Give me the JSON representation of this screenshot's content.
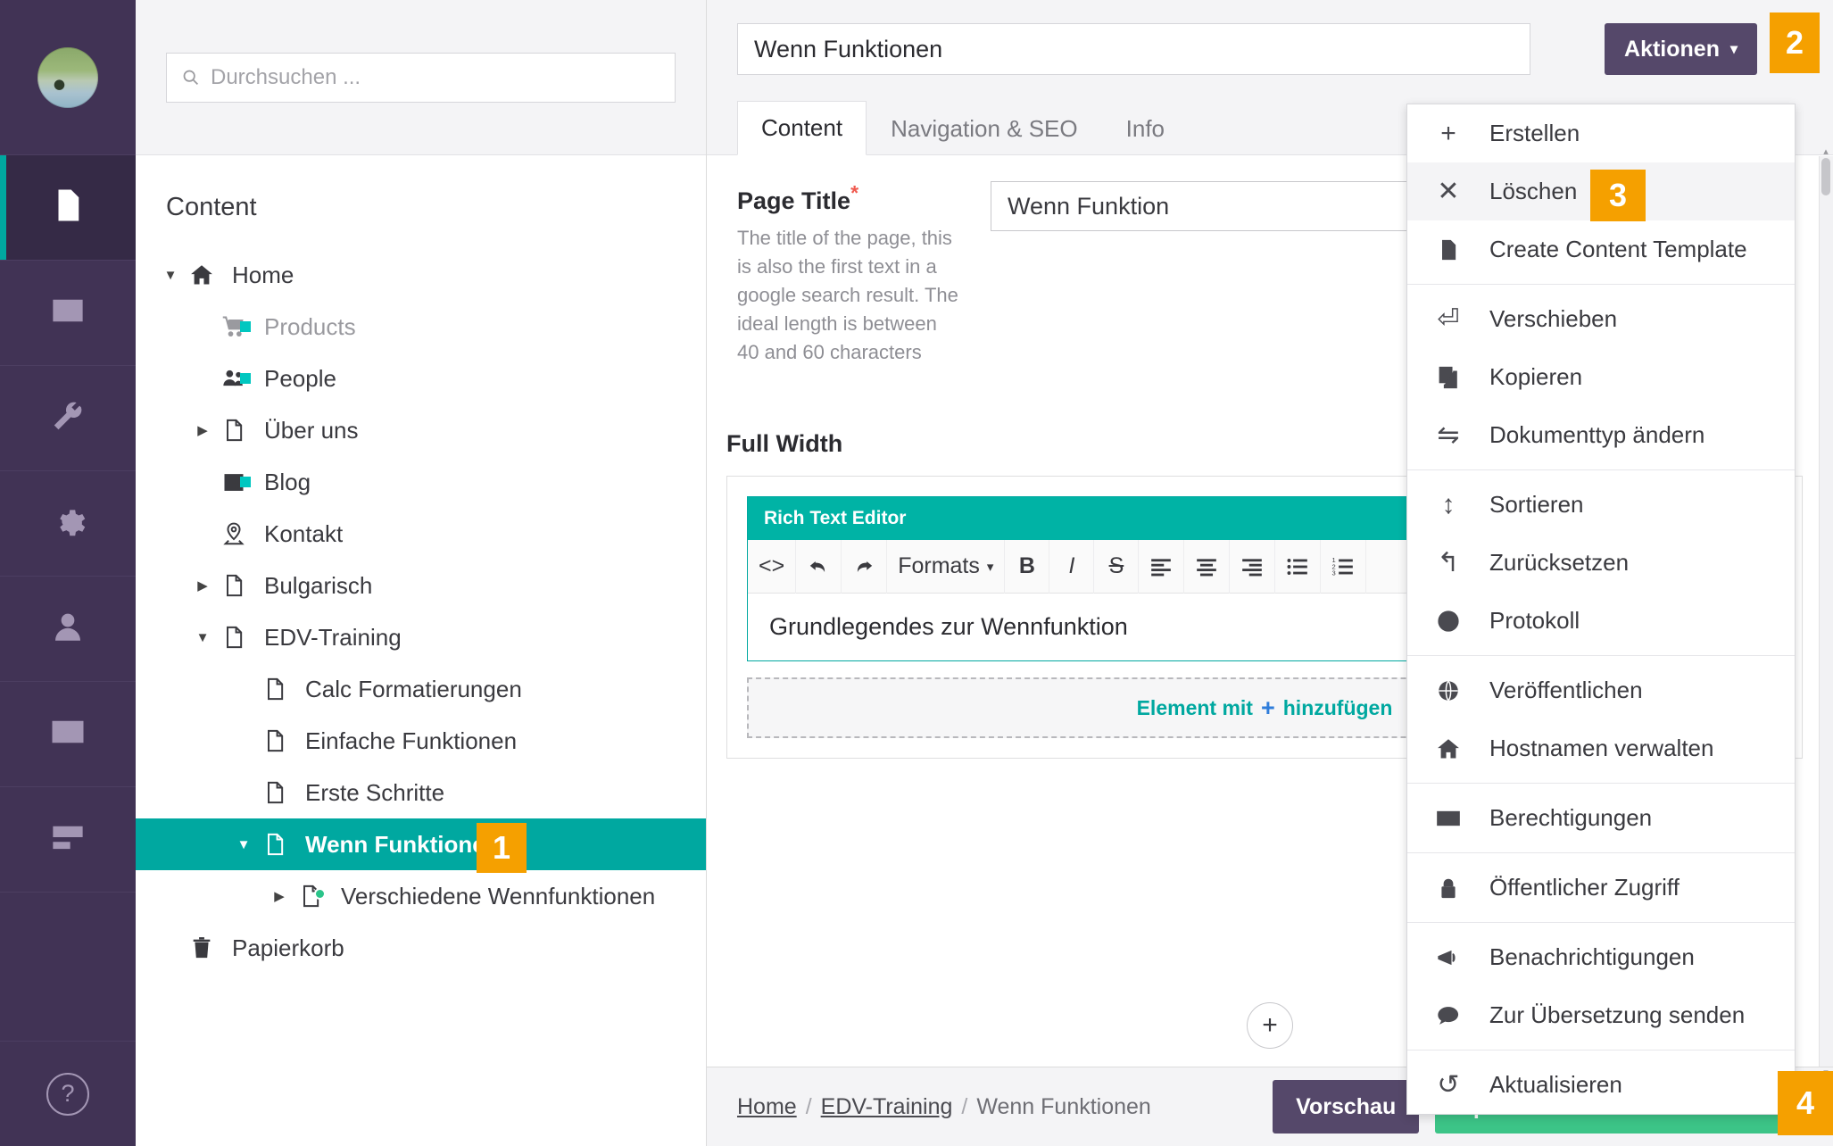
{
  "colors": {
    "rail_bg": "#413355",
    "rail_active": "#352a46",
    "teal": "#00a8a0",
    "orange": "#f5a000",
    "green_publish": "#3cc487",
    "purple_button": "#55486a",
    "required_red": "#f05a4f"
  },
  "rail": {
    "avatar_name": "user-avatar",
    "items": [
      {
        "name": "sidebar-item-content",
        "icon": "document-icon",
        "active": true
      },
      {
        "name": "sidebar-item-media",
        "icon": "image-icon",
        "active": false
      },
      {
        "name": "sidebar-item-settings",
        "icon": "wrench-icon",
        "active": false
      },
      {
        "name": "sidebar-item-packages",
        "icon": "gear-icon",
        "active": false
      },
      {
        "name": "sidebar-item-users",
        "icon": "user-icon",
        "active": false
      },
      {
        "name": "sidebar-item-members",
        "icon": "id-card-icon",
        "active": false
      },
      {
        "name": "sidebar-item-forms",
        "icon": "forms-icon",
        "active": false
      }
    ],
    "help_glyph": "?"
  },
  "search": {
    "placeholder": "Durchsuchen ...",
    "value": "",
    "icon": "search-icon"
  },
  "tree": {
    "title": "Content",
    "nodes": [
      {
        "label": "Home",
        "level": 1,
        "caret": "down",
        "icon": "home-icon",
        "dim": false,
        "selected": false,
        "dot": false
      },
      {
        "label": "Products",
        "level": 2,
        "caret": "none",
        "icon": "cart-icon",
        "dim": true,
        "selected": false,
        "dot": false
      },
      {
        "label": "People",
        "level": 2,
        "caret": "none",
        "icon": "people-icon",
        "dim": false,
        "selected": false,
        "dot": false
      },
      {
        "label": "Über uns",
        "level": 2,
        "caret": "right",
        "icon": "page-icon",
        "dim": false,
        "selected": false,
        "dot": false
      },
      {
        "label": "Blog",
        "level": 2,
        "caret": "none",
        "icon": "calendar-icon",
        "dim": false,
        "selected": false,
        "dot": false
      },
      {
        "label": "Kontakt",
        "level": 2,
        "caret": "none",
        "icon": "pin-icon",
        "dim": false,
        "selected": false,
        "dot": false
      },
      {
        "label": "Bulgarisch",
        "level": 2,
        "caret": "right",
        "icon": "page-icon",
        "dim": false,
        "selected": false,
        "dot": false
      },
      {
        "label": "EDV-Training",
        "level": 2,
        "caret": "down",
        "icon": "page-icon",
        "dim": false,
        "selected": false,
        "dot": false
      },
      {
        "label": "Calc Formatierungen",
        "level": 3,
        "caret": "none",
        "icon": "page-icon",
        "dim": false,
        "selected": false,
        "dot": false
      },
      {
        "label": "Einfache Funktionen",
        "level": 3,
        "caret": "none",
        "icon": "page-icon",
        "dim": false,
        "selected": false,
        "dot": false
      },
      {
        "label": "Erste Schritte",
        "level": 3,
        "caret": "none",
        "icon": "page-icon",
        "dim": false,
        "selected": false,
        "dot": false
      },
      {
        "label": "Wenn Funktionen",
        "level": 3,
        "caret": "down",
        "icon": "page-icon",
        "dim": false,
        "selected": true,
        "dot": false
      },
      {
        "label": "Verschiedene Wennfunktionen",
        "level": 4,
        "caret": "right",
        "icon": "page-icon",
        "dim": false,
        "selected": false,
        "dot": true
      },
      {
        "label": "Papierkorb",
        "level": 1,
        "caret": "none",
        "icon": "trash-icon",
        "dim": false,
        "selected": false,
        "dot": false
      }
    ]
  },
  "editor": {
    "name_value": "Wenn Funktionen",
    "actions_label": "Aktionen",
    "actions_caret": "chevron-down-icon",
    "tabs": [
      {
        "label": "Content",
        "active": true
      },
      {
        "label": "Navigation & SEO",
        "active": false
      },
      {
        "label": "Info",
        "active": false
      }
    ],
    "property": {
      "label": "Page Title",
      "required_marker": "*",
      "description": "The title of the page, this is also the first text in a google search result. The ideal length is between 40 and 60 characters",
      "value": "Wenn Funktion"
    },
    "grid": {
      "section_label": "Full Width",
      "rte_title": "Rich Text Editor",
      "rte_content": "Grundlegendes zur Wennfunktion",
      "toolbar": [
        {
          "name": "source-code-button",
          "glyph": "<>"
        },
        {
          "name": "undo-button",
          "glyph": ""
        },
        {
          "name": "redo-button",
          "glyph": ""
        },
        {
          "name": "formats-dropdown",
          "glyph": "Formats"
        },
        {
          "name": "bold-button",
          "glyph": "B"
        },
        {
          "name": "italic-button",
          "glyph": "I"
        },
        {
          "name": "strikethrough-button",
          "glyph": "S"
        },
        {
          "name": "align-left-button",
          "glyph": ""
        },
        {
          "name": "align-center-button",
          "glyph": ""
        },
        {
          "name": "align-right-button",
          "glyph": ""
        },
        {
          "name": "bullet-list-button",
          "glyph": ""
        },
        {
          "name": "numbered-list-button",
          "glyph": ""
        }
      ],
      "add_element_pre": "Element mit",
      "add_element_plus": "+",
      "add_element_post": "hinzufügen",
      "add_row_glyph": "+"
    }
  },
  "actions_menu": {
    "items": [
      {
        "label": "Erstellen",
        "icon": "plus-icon",
        "highlight": false,
        "sep_after": false
      },
      {
        "label": "Löschen",
        "icon": "close-icon",
        "highlight": true,
        "sep_after": false
      },
      {
        "label": "Create Content Template",
        "icon": "content-template-icon",
        "highlight": false,
        "sep_after": true
      },
      {
        "label": "Verschieben",
        "icon": "move-icon",
        "highlight": false,
        "sep_after": false
      },
      {
        "label": "Kopieren",
        "icon": "copy-icon",
        "highlight": false,
        "sep_after": false
      },
      {
        "label": "Dokumenttyp ändern",
        "icon": "swap-icon",
        "highlight": false,
        "sep_after": true
      },
      {
        "label": "Sortieren",
        "icon": "sort-icon",
        "highlight": false,
        "sep_after": false
      },
      {
        "label": "Zurücksetzen",
        "icon": "rollback-icon",
        "highlight": false,
        "sep_after": false
      },
      {
        "label": "Protokoll",
        "icon": "clock-icon",
        "highlight": false,
        "sep_after": true
      },
      {
        "label": "Veröffentlichen",
        "icon": "globe-icon",
        "highlight": false,
        "sep_after": false
      },
      {
        "label": "Hostnamen verwalten",
        "icon": "home-icon",
        "highlight": false,
        "sep_after": true
      },
      {
        "label": "Berechtigungen",
        "icon": "permissions-icon",
        "highlight": false,
        "sep_after": true
      },
      {
        "label": "Öffentlicher Zugriff",
        "icon": "lock-icon",
        "highlight": false,
        "sep_after": true
      },
      {
        "label": "Benachrichtigungen",
        "icon": "megaphone-icon",
        "highlight": false,
        "sep_after": false
      },
      {
        "label": "Zur Übersetzung senden",
        "icon": "speech-bubble-icon",
        "highlight": false,
        "sep_after": true
      },
      {
        "label": "Aktualisieren",
        "icon": "refresh-icon",
        "highlight": false,
        "sep_after": false
      }
    ]
  },
  "footer": {
    "breadcrumb": [
      {
        "label": "Home",
        "link": true
      },
      {
        "label": "EDV-Training",
        "link": true
      },
      {
        "label": "Wenn Funktionen",
        "link": false
      }
    ],
    "separator": "/",
    "preview_label": "Vorschau",
    "publish_label": "Speichern und veröffentlichen"
  },
  "steps": {
    "one": "1",
    "two": "2",
    "three": "3",
    "four": "4"
  }
}
